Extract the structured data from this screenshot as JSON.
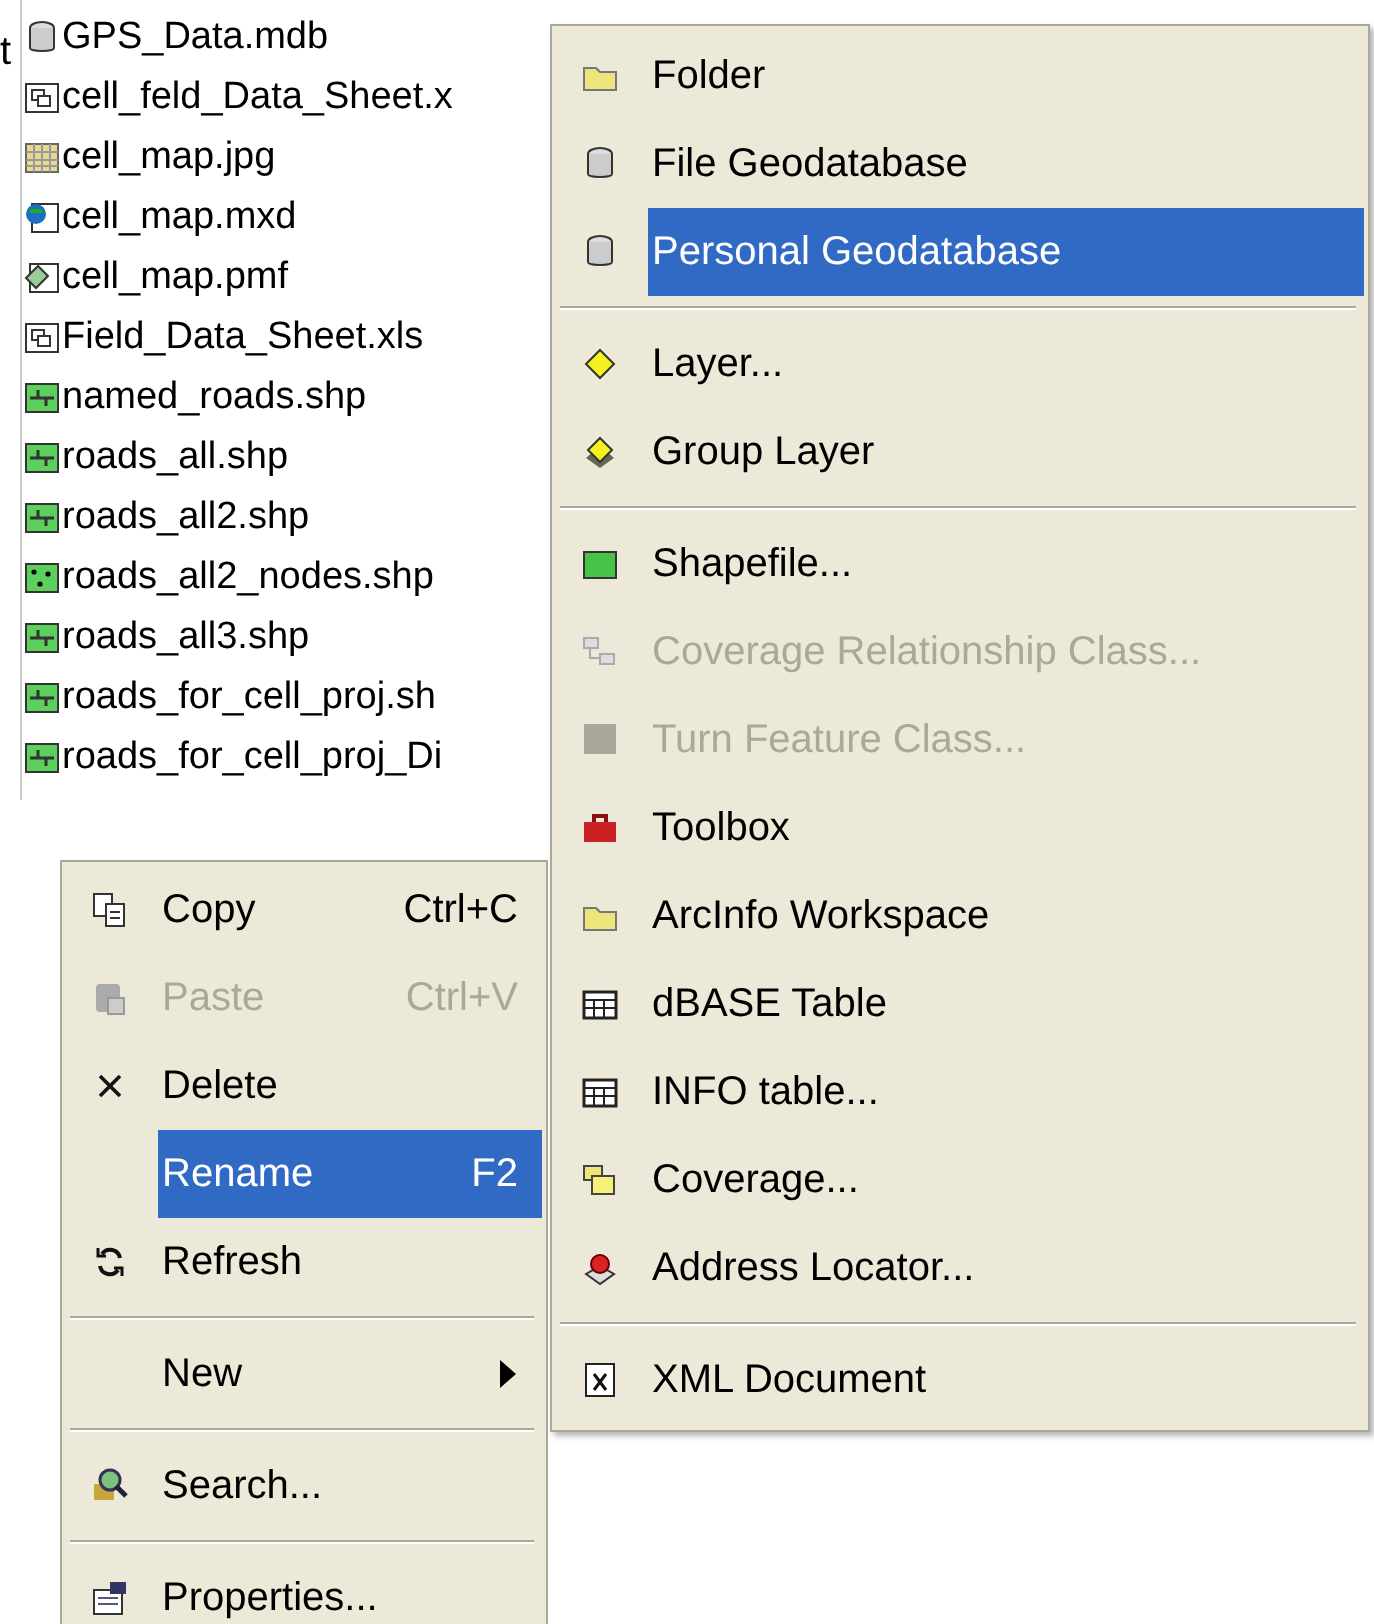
{
  "stray_text": "t",
  "files": [
    {
      "name": "GPS_Data.mdb",
      "kind": "database"
    },
    {
      "name": "cell_feld_Data_Sheet.x",
      "kind": "sheet"
    },
    {
      "name": "cell_map.jpg",
      "kind": "raster"
    },
    {
      "name": "cell_map.mxd",
      "kind": "mapdoc"
    },
    {
      "name": "cell_map.pmf",
      "kind": "publish"
    },
    {
      "name": "Field_Data_Sheet.xls",
      "kind": "sheet"
    },
    {
      "name": "named_roads.shp",
      "kind": "line"
    },
    {
      "name": "roads_all.shp",
      "kind": "line"
    },
    {
      "name": "roads_all2.shp",
      "kind": "line"
    },
    {
      "name": "roads_all2_nodes.shp",
      "kind": "point"
    },
    {
      "name": "roads_all3.shp",
      "kind": "line"
    },
    {
      "name": "roads_for_cell_proj.sh",
      "kind": "line"
    },
    {
      "name": "roads_for_cell_proj_Di",
      "kind": "line"
    }
  ],
  "context_menu": [
    {
      "kind": "copy",
      "label": "Copy",
      "shortcut": "Ctrl+C",
      "disabled": false,
      "selected": false
    },
    {
      "kind": "paste",
      "label": "Paste",
      "shortcut": "Ctrl+V",
      "disabled": true,
      "selected": false
    },
    {
      "kind": "delete",
      "label": "Delete",
      "disabled": false,
      "selected": false
    },
    {
      "kind": "plain",
      "label": "Rename",
      "shortcut": "F2",
      "disabled": false,
      "selected": true
    },
    {
      "kind": "refresh",
      "label": "Refresh",
      "disabled": false,
      "selected": false
    },
    {
      "kind": "separator"
    },
    {
      "kind": "submenu",
      "label": "New",
      "disabled": false,
      "selected": false
    },
    {
      "kind": "separator"
    },
    {
      "kind": "search",
      "label": "Search...",
      "disabled": false,
      "selected": false
    },
    {
      "kind": "separator"
    },
    {
      "kind": "properties",
      "label": "Properties...",
      "disabled": false,
      "selected": false
    }
  ],
  "new_submenu": [
    {
      "kind": "folder",
      "label": "Folder",
      "disabled": false,
      "selected": false
    },
    {
      "kind": "database",
      "label": "File Geodatabase",
      "disabled": false,
      "selected": false
    },
    {
      "kind": "database",
      "label": "Personal Geodatabase",
      "disabled": false,
      "selected": true
    },
    {
      "kind": "separator"
    },
    {
      "kind": "layer",
      "label": "Layer...",
      "disabled": false,
      "selected": false
    },
    {
      "kind": "grouplayer",
      "label": "Group Layer",
      "disabled": false,
      "selected": false
    },
    {
      "kind": "separator"
    },
    {
      "kind": "shapefile",
      "label": "Shapefile...",
      "disabled": false,
      "selected": false
    },
    {
      "kind": "relationship",
      "label": "Coverage Relationship Class...",
      "disabled": true,
      "selected": false
    },
    {
      "kind": "turn",
      "label": "Turn Feature Class...",
      "disabled": true,
      "selected": false
    },
    {
      "kind": "toolbox",
      "label": "Toolbox",
      "disabled": false,
      "selected": false
    },
    {
      "kind": "folder",
      "label": "ArcInfo Workspace",
      "disabled": false,
      "selected": false
    },
    {
      "kind": "table",
      "label": "dBASE Table",
      "disabled": false,
      "selected": false
    },
    {
      "kind": "table",
      "label": "INFO table...",
      "disabled": false,
      "selected": false
    },
    {
      "kind": "coverage",
      "label": "Coverage...",
      "disabled": false,
      "selected": false
    },
    {
      "kind": "locator",
      "label": "Address Locator...",
      "disabled": false,
      "selected": false
    },
    {
      "kind": "separator"
    },
    {
      "kind": "xml",
      "label": "XML Document",
      "disabled": false,
      "selected": false
    }
  ]
}
